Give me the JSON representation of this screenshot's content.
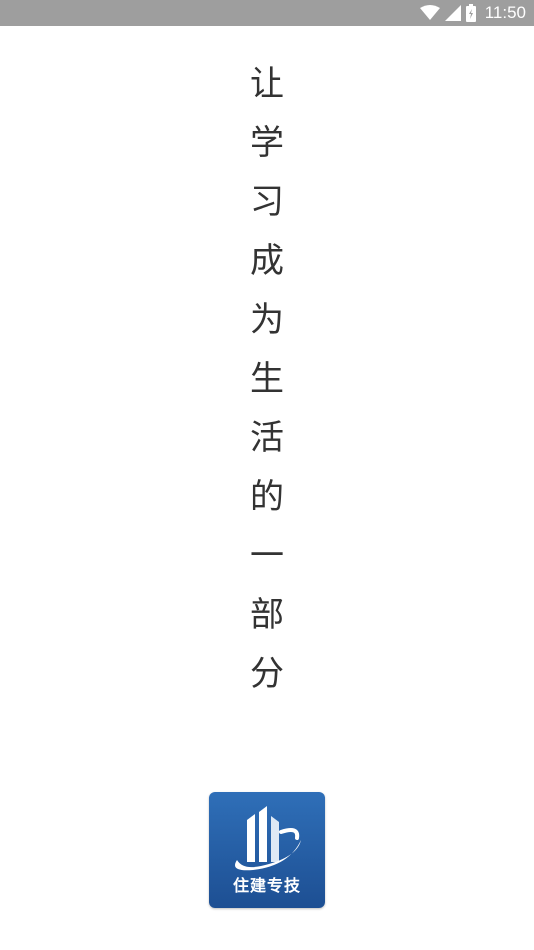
{
  "status_bar": {
    "time": "11:50",
    "icons": [
      "wifi-icon",
      "signal-icon",
      "battery-icon"
    ],
    "background": "#9e9e9e"
  },
  "slogan": {
    "chars": [
      "让",
      "学",
      "习",
      "成",
      "为",
      "生",
      "活",
      "的",
      "一",
      "部",
      "分"
    ]
  },
  "logo": {
    "text": "住建专技",
    "background": "#2459a3"
  }
}
